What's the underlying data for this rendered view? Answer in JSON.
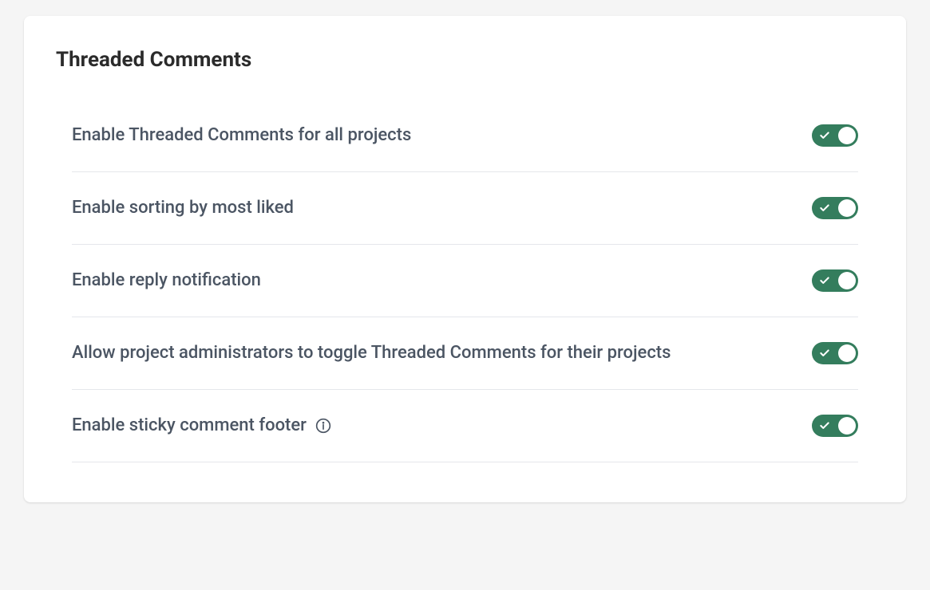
{
  "section": {
    "title": "Threaded Comments"
  },
  "settings": [
    {
      "label": "Enable Threaded Comments for all projects",
      "on": true,
      "info": false
    },
    {
      "label": "Enable sorting by most liked",
      "on": true,
      "info": false
    },
    {
      "label": "Enable reply notification",
      "on": true,
      "info": false
    },
    {
      "label": "Allow project administrators to toggle Threaded Comments for their projects",
      "on": true,
      "info": false
    },
    {
      "label": "Enable sticky comment footer",
      "on": true,
      "info": true
    }
  ]
}
